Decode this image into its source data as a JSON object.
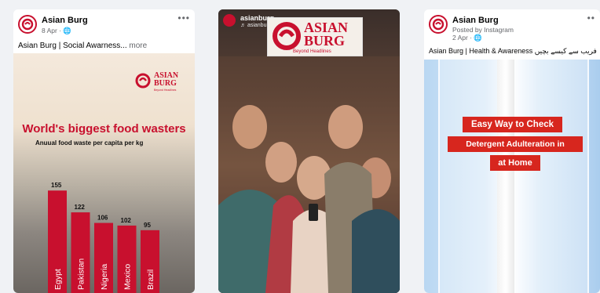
{
  "cards": [
    {
      "page_name": "Asian Burg",
      "meta": "8 Apr · ",
      "caption": "Asian Burg | Social Awarness...",
      "caption_more": " more",
      "logo_word_1": "ASIAN",
      "logo_word_2": "BURG",
      "logo_tag": "Beyond Headlines"
    },
    {
      "page_name": "asianburg",
      "meta": "♬ asianburg · Original audio",
      "logo_word_1": "ASIAN",
      "logo_word_2": "BURG",
      "logo_tag": "Beyond Headlines"
    },
    {
      "page_name": "Asian Burg",
      "meta_line1": "Posted by Instagram",
      "meta_line2": "2 Apr · ",
      "caption": "Asian Burg | Health & Awareness فریب سے کیسے بچیں",
      "banner_1": "Easy Way to Check",
      "banner_2": "Detergent Adulteration in",
      "banner_3": "at Home"
    }
  ],
  "chart_data": {
    "type": "bar",
    "title": "World's biggest food wasters",
    "subtitle": "Anuual food waste per capita per kg",
    "categories": [
      "Egypt",
      "Pakistan",
      "Nigeria",
      "Mexico",
      "Brazil"
    ],
    "values": [
      155,
      122,
      106,
      102,
      95
    ],
    "ylim": [
      0,
      160
    ],
    "bar_color": "#c8102e"
  },
  "colors": {
    "brand_red": "#c8102e",
    "banner_red": "#d7261e"
  },
  "icons": [
    "globe-icon",
    "more-options-icon",
    "logo-icon",
    "music-note-icon"
  ]
}
